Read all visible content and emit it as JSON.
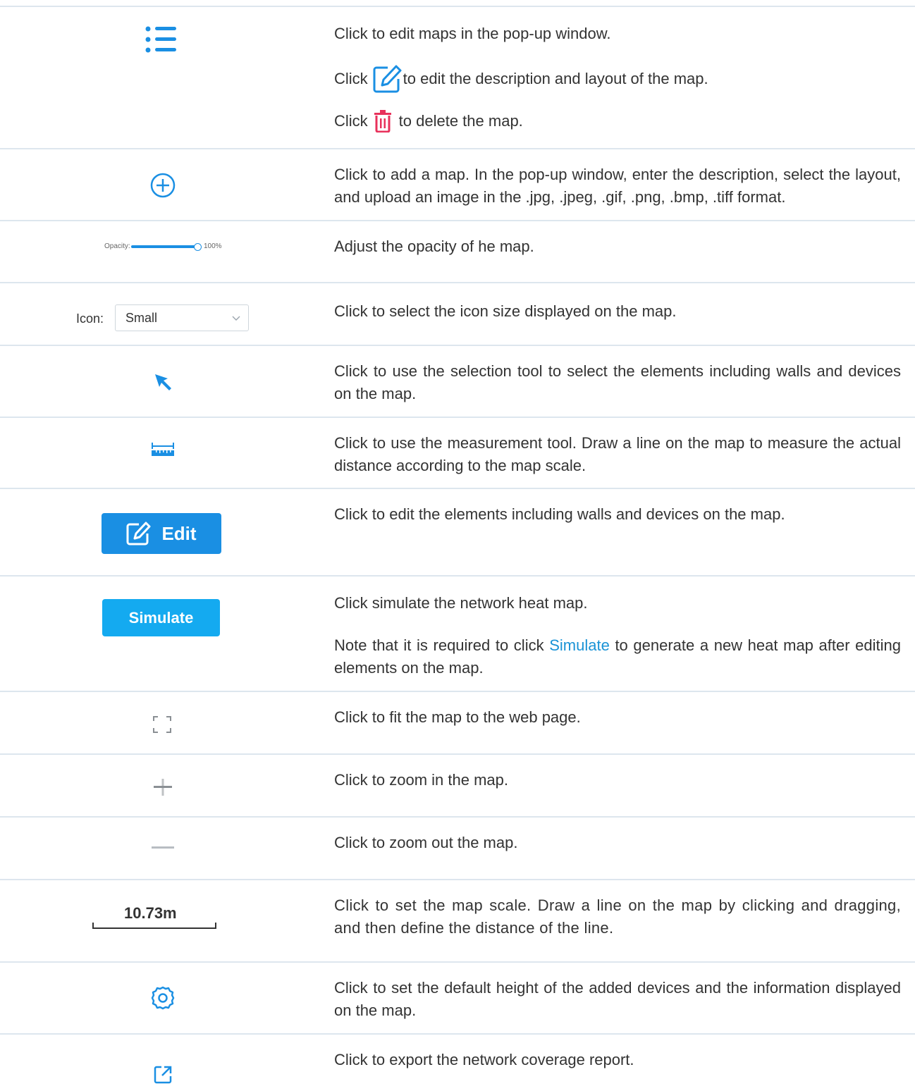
{
  "colors": {
    "accent": "#1a8fe3",
    "delete": "#e8315b",
    "separator": "#dde6ee",
    "link": "#1a93d6"
  },
  "rows": [
    {
      "icon": "list-icon",
      "lines": [
        "Click to edit maps in the pop-up window."
      ],
      "edit_line": {
        "before": "Click",
        "after": "to edit the description and layout of the map.",
        "icon": "edit-icon"
      },
      "delete_line": {
        "before": "Click",
        "after": "to delete the map.",
        "icon": "trash-icon"
      }
    },
    {
      "icon": "add-circle-icon",
      "text": "Click to add a map. In the pop-up window, enter the description, select the layout, and upload an image in the .jpg, .jpeg, .gif, .png, .bmp, .tiff format."
    },
    {
      "icon": "opacity-slider",
      "slider": {
        "label": "Opacity:",
        "value_text": "100%",
        "value": 1.0
      },
      "text": "Adjust the opacity of he map."
    },
    {
      "icon": "icon-size-select",
      "select": {
        "label": "Icon:",
        "value": "Small"
      },
      "text": "Click to select the icon size displayed on the map."
    },
    {
      "icon": "cursor-arrow-icon",
      "text": "Click to use the selection tool to select the elements including walls and devices on the map."
    },
    {
      "icon": "ruler-icon",
      "text": "Click to use the measurement tool. Draw a line on the map to measure the actual distance according to the map scale."
    },
    {
      "icon": "edit-button",
      "button_label": "Edit",
      "text": "Click to edit the elements including walls and devices on the map."
    },
    {
      "icon": "simulate-button",
      "button_label": "Simulate",
      "text": "Click simulate the network heat map.",
      "note": {
        "before": "Note that it is required to click",
        "link": "Simulate",
        "after": "to generate a new heat map after editing elements on the map."
      }
    },
    {
      "icon": "fit-screen-icon",
      "text": "Click to fit the map to the web page."
    },
    {
      "icon": "zoom-in-icon",
      "text": "Click to zoom in the map."
    },
    {
      "icon": "zoom-out-icon",
      "text": "Click to zoom out the map."
    },
    {
      "icon": "map-scale",
      "scale_label": "10.73m",
      "text": "Click to set the map scale. Draw a line on the map by clicking and dragging, and then define the distance of the line."
    },
    {
      "icon": "gear-icon",
      "text": "Click to set the default height of the added devices and the information displayed on the map."
    },
    {
      "icon": "export-icon",
      "text": "Click to export the network coverage report."
    }
  ]
}
